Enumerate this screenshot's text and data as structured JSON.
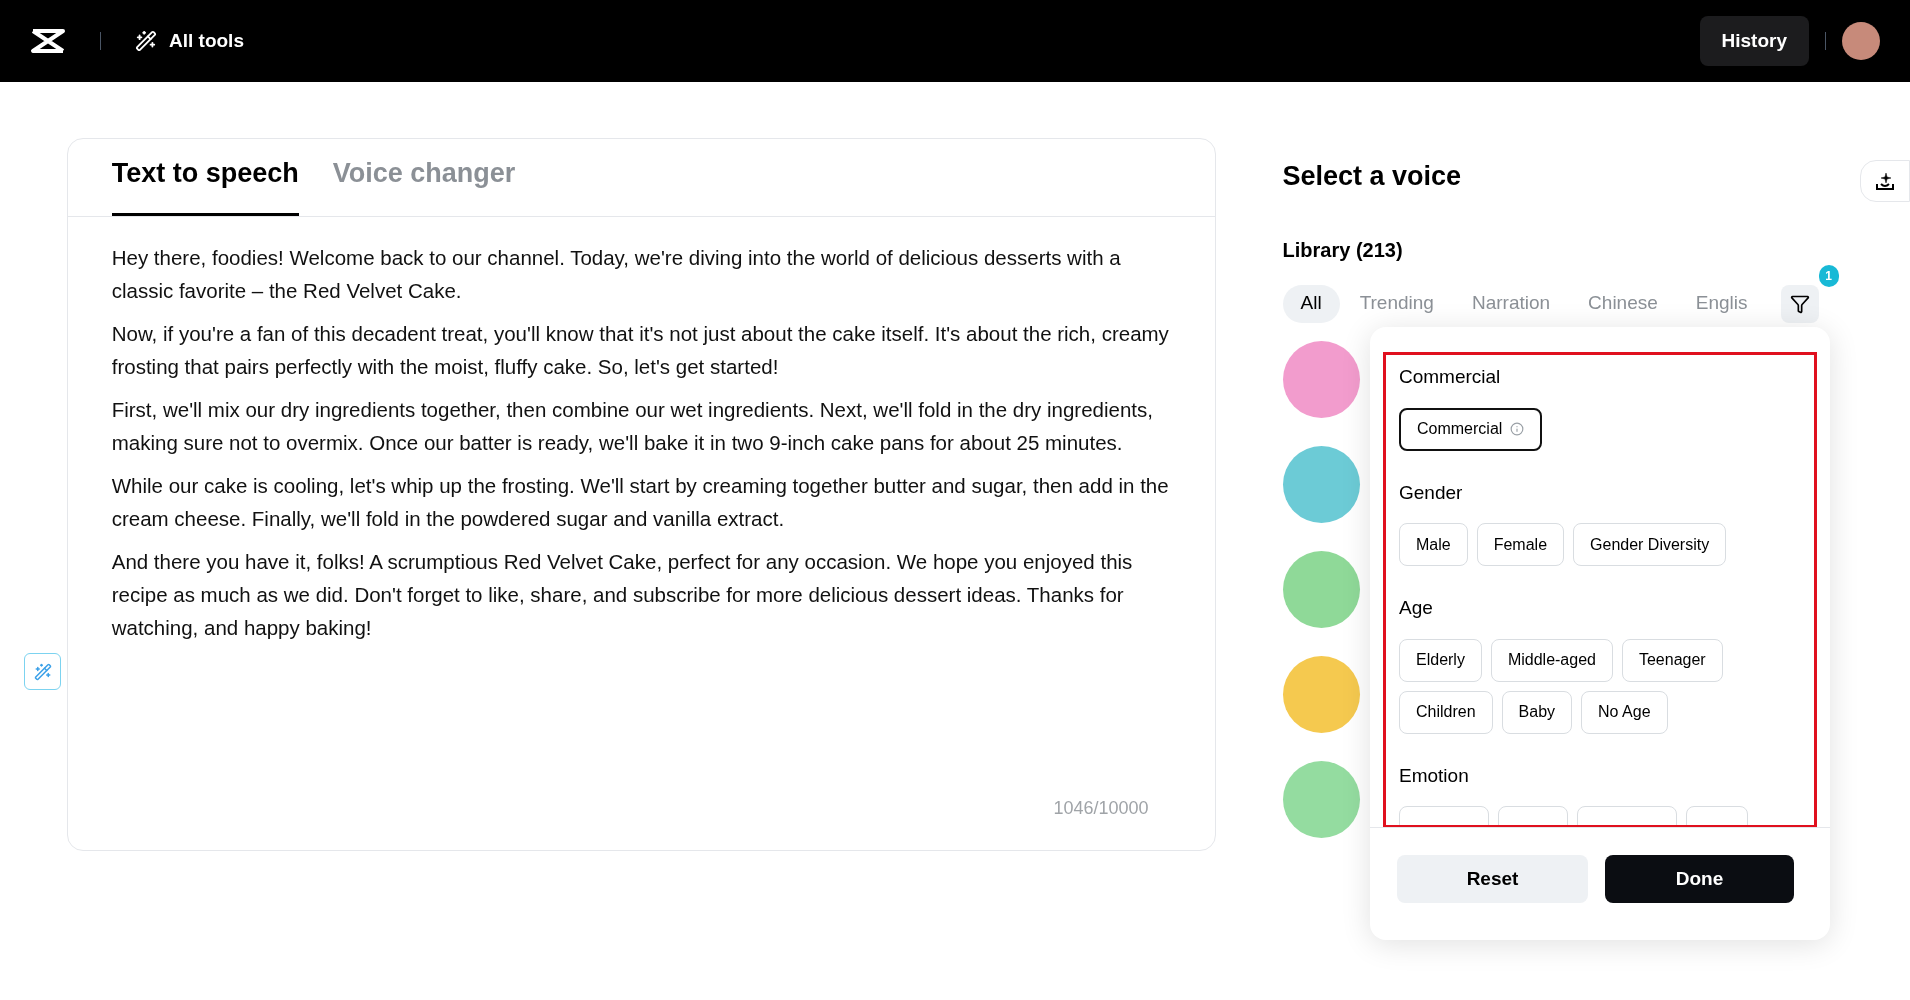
{
  "header": {
    "tools_label": "All tools",
    "history_button": "History"
  },
  "tabs": [
    {
      "label": "Text to speech",
      "selected": true
    },
    {
      "label": "Voice changer",
      "selected": false
    }
  ],
  "editor": {
    "paragraphs": [
      "Hey there, foodies! Welcome back to our channel. Today, we're diving into the world of delicious desserts with a classic favorite – the Red Velvet Cake.",
      "Now, if you're a fan of this decadent treat, you'll know that it's not just about the cake itself. It's about the rich, creamy frosting that pairs perfectly with the moist, fluffy cake. So, let's get started!",
      "First, we'll mix our dry ingredients together, then combine our wet ingredients. Next, we'll fold in the dry ingredients, making sure not to overmix. Once our batter is ready, we'll bake it in two 9-inch cake pans for about 25 minutes.",
      "While our cake is cooling, let's whip up the frosting. We'll start by creaming together butter and sugar, then add in the cream cheese. Finally, we'll fold in the powdered sugar and vanilla extract.",
      "And there you have it, folks! A scrumptious Red Velvet Cake, perfect for any occasion. We hope you enjoyed this recipe as much as we did. Don't forget to like, share, and subscribe for more delicious dessert ideas. Thanks for watching, and happy baking!"
    ],
    "counter": "1046/10000"
  },
  "voice_panel": {
    "title": "Select a voice",
    "library": "Library (213)",
    "categories": [
      {
        "label": "All",
        "selected": true
      },
      {
        "label": "Trending",
        "selected": false
      },
      {
        "label": "Narration",
        "selected": false
      },
      {
        "label": "Chinese",
        "selected": false
      },
      {
        "label": "Englis",
        "selected": false
      }
    ],
    "filter_badge": "1",
    "avatars": [
      {
        "color": "#f29ccd"
      },
      {
        "color": "#6ccbd6"
      },
      {
        "color": "#8fd998"
      },
      {
        "color": "#f5c94f"
      },
      {
        "color": "#94dca0"
      }
    ]
  },
  "filter_popover": {
    "groups": [
      {
        "title": "Commercial",
        "options": [
          {
            "label": "Commercial",
            "selected": true,
            "info": true
          }
        ]
      },
      {
        "title": "Gender",
        "options": [
          {
            "label": "Male",
            "selected": false
          },
          {
            "label": "Female",
            "selected": false
          },
          {
            "label": "Gender Diversity",
            "selected": false
          }
        ]
      },
      {
        "title": "Age",
        "options": [
          {
            "label": "Elderly",
            "selected": false
          },
          {
            "label": "Middle-aged",
            "selected": false
          },
          {
            "label": "Teenager",
            "selected": false
          },
          {
            "label": "Children",
            "selected": false
          },
          {
            "label": "Baby",
            "selected": false
          },
          {
            "label": "No Age",
            "selected": false
          }
        ]
      },
      {
        "title": "Emotion"
      }
    ],
    "reset_button": "Reset",
    "done_button": "Done"
  }
}
